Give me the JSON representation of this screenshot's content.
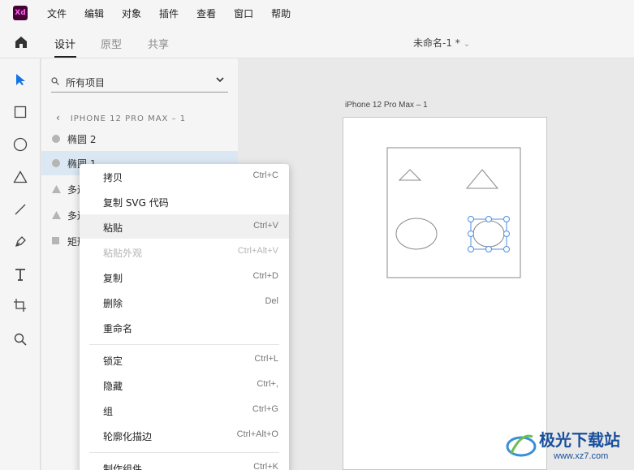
{
  "app": {
    "logo_text": "Xd"
  },
  "menubar": {
    "items": [
      "文件",
      "编辑",
      "对象",
      "插件",
      "查看",
      "窗口",
      "帮助"
    ]
  },
  "toolbar": {
    "tabs": [
      "设计",
      "原型",
      "共享"
    ],
    "active_tab": "设计",
    "doc_title": "未命名-1 *",
    "doc_title_chevron": "⌄"
  },
  "tools": [
    "select-arrow-icon",
    "rectangle-icon",
    "ellipse-icon",
    "triangle-icon",
    "line-icon",
    "pen-icon",
    "text-icon",
    "artboard-icon",
    "zoom-icon"
  ],
  "layers": {
    "search_value": "所有项目",
    "breadcrumb": "IPHONE 12 PRO MAX – 1",
    "rows": [
      {
        "label": "椭圆 2",
        "icon": "ellipse-layer-icon"
      },
      {
        "label": "椭圆 1",
        "icon": "ellipse-layer-icon",
        "selected": true
      },
      {
        "label": "多边",
        "icon": "triangle-layer-icon"
      },
      {
        "label": "多边",
        "icon": "triangle-layer-icon"
      },
      {
        "label": "矩形",
        "icon": "rectangle-layer-icon"
      }
    ]
  },
  "canvas": {
    "artboard_label": "iPhone 12 Pro Max – 1"
  },
  "context_menu": {
    "items": [
      {
        "label": "拷贝",
        "shortcut": "Ctrl+C"
      },
      {
        "label": "复制 SVG 代码",
        "shortcut": ""
      },
      {
        "label": "粘贴",
        "shortcut": "Ctrl+V",
        "hover": true
      },
      {
        "label": "粘贴外观",
        "shortcut": "Ctrl+Alt+V",
        "disabled": true
      },
      {
        "label": "复制",
        "shortcut": "Ctrl+D"
      },
      {
        "label": "删除",
        "shortcut": "Del"
      },
      {
        "label": "重命名",
        "shortcut": ""
      },
      {
        "label": "锁定",
        "shortcut": "Ctrl+L"
      },
      {
        "label": "隐藏",
        "shortcut": "Ctrl+,"
      },
      {
        "label": "组",
        "shortcut": "Ctrl+G"
      },
      {
        "label": "轮廓化描边",
        "shortcut": "Ctrl+Alt+O"
      },
      {
        "label": "制作组件",
        "shortcut": "Ctrl+K"
      }
    ]
  },
  "watermark": {
    "title": "极光下载站",
    "url": "www.xz7.com"
  },
  "colors": {
    "selection_blue": "#4a90e2",
    "selected_row": "#dbe8f4",
    "xd_logo_bg": "#470137",
    "xd_logo_fg": "#ff61f6"
  }
}
